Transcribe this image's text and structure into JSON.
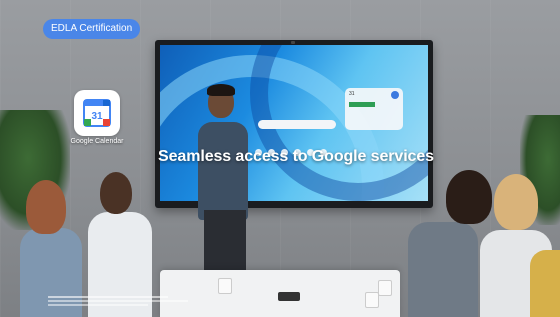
{
  "badge": {
    "label": "EDLA Certification"
  },
  "app": {
    "icon": "google-calendar-icon",
    "icon_number": "31",
    "label": "Google Calendar"
  },
  "headline": "Seamless access to Google services",
  "tv": {
    "widget_number": "31"
  },
  "colors": {
    "badge": "#4a86e8",
    "calendar_blue": "#4285f4",
    "calendar_green": "#34a853",
    "calendar_yellow": "#fbbc04",
    "calendar_red": "#ea4335"
  }
}
